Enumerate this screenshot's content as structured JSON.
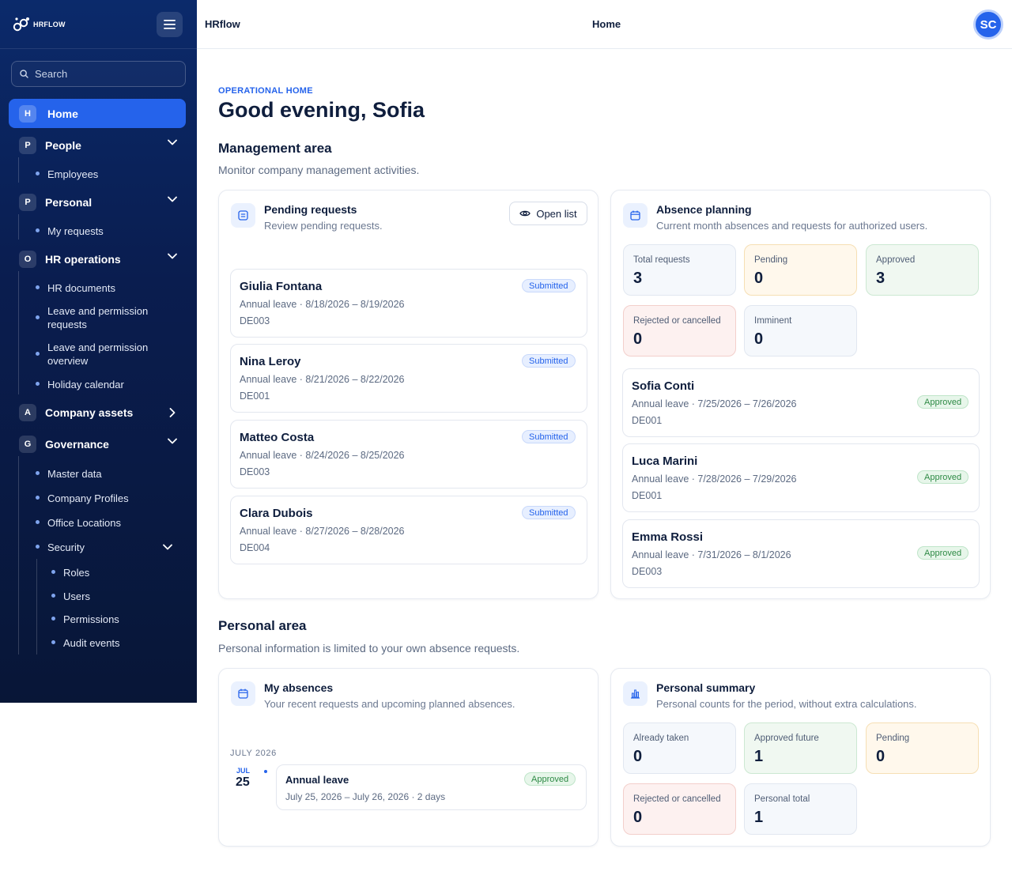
{
  "sidebar": {
    "logo_text": "HRFLOW",
    "search_placeholder": "Search",
    "home": {
      "letter": "H",
      "label": "Home"
    },
    "groups": {
      "people": {
        "letter": "P",
        "label": "People",
        "items": [
          "Employees"
        ]
      },
      "personal": {
        "letter": "P",
        "label": "Personal",
        "items": [
          "My requests"
        ]
      },
      "hr_operations": {
        "letter": "O",
        "label": "HR operations",
        "items": [
          "HR documents",
          "Leave and permission requests",
          "Leave and permission overview",
          "Holiday calendar"
        ]
      },
      "company_assets": {
        "letter": "A",
        "label": "Company assets"
      },
      "governance": {
        "letter": "G",
        "label": "Governance",
        "items": [
          "Master data",
          "Company Profiles",
          "Office Locations",
          "Security"
        ]
      },
      "security": {
        "items": [
          "Roles",
          "Users",
          "Permissions",
          "Audit events"
        ]
      }
    }
  },
  "topbar": {
    "app_name": "HRflow",
    "page": "Home",
    "avatar_initials": "SC"
  },
  "main": {
    "eyebrow": "OPERATIONAL HOME",
    "greeting": "Good evening, Sofia",
    "management": {
      "title": "Management area",
      "subtitle": "Monitor company management activities.",
      "pending": {
        "title": "Pending requests",
        "subtitle": "Review pending requests.",
        "open_label": "Open list",
        "requests": [
          {
            "name": "Giulia Fontana",
            "line": "Annual leave · 8/18/2026 – 8/19/2026",
            "code": "DE003",
            "status": "Submitted"
          },
          {
            "name": "Nina Leroy",
            "line": "Annual leave · 8/21/2026 – 8/22/2026",
            "code": "DE001",
            "status": "Submitted"
          },
          {
            "name": "Matteo Costa",
            "line": "Annual leave · 8/24/2026 – 8/25/2026",
            "code": "DE003",
            "status": "Submitted"
          },
          {
            "name": "Clara Dubois",
            "line": "Annual leave · 8/27/2026 – 8/28/2026",
            "code": "DE004",
            "status": "Submitted"
          }
        ]
      },
      "absence": {
        "title": "Absence planning",
        "subtitle": "Current month absences and requests for authorized users.",
        "stats": [
          {
            "label": "Total requests",
            "value": "3"
          },
          {
            "label": "Pending",
            "value": "0"
          },
          {
            "label": "Approved",
            "value": "3"
          },
          {
            "label": "Rejected or cancelled",
            "value": "0"
          },
          {
            "label": "Imminent",
            "value": "0"
          }
        ],
        "entries": [
          {
            "name": "Sofia Conti",
            "line": "Annual leave · 7/25/2026 – 7/26/2026",
            "code": "DE001",
            "status": "Approved"
          },
          {
            "name": "Luca Marini",
            "line": "Annual leave · 7/28/2026 – 7/29/2026",
            "code": "DE001",
            "status": "Approved"
          },
          {
            "name": "Emma Rossi",
            "line": "Annual leave · 7/31/2026 – 8/1/2026",
            "code": "DE003",
            "status": "Approved"
          }
        ]
      }
    },
    "personal": {
      "title": "Personal area",
      "subtitle": "Personal information is limited to your own absence requests.",
      "absences": {
        "title": "My absences",
        "subtitle": "Your recent requests and upcoming planned absences.",
        "month": "JULY 2026",
        "day_month": "JUL",
        "day": "25",
        "item": {
          "title": "Annual leave",
          "line": "July 25, 2026 – July 26, 2026 · 2 days",
          "status": "Approved"
        }
      },
      "summary": {
        "title": "Personal summary",
        "subtitle": "Personal counts for the period, without extra calculations.",
        "stats": [
          {
            "label": "Already taken",
            "value": "0"
          },
          {
            "label": "Approved future",
            "value": "1"
          },
          {
            "label": "Pending",
            "value": "0"
          },
          {
            "label": "Rejected or cancelled",
            "value": "0"
          },
          {
            "label": "Personal total",
            "value": "1"
          }
        ]
      }
    }
  },
  "colors": {
    "accent": "#2563eb",
    "sidebar_bg": "#0a1d4f",
    "approved": "#2e8a45",
    "pending_bg": "#fff8ec",
    "rejected_bg": "#fdf1f0"
  }
}
